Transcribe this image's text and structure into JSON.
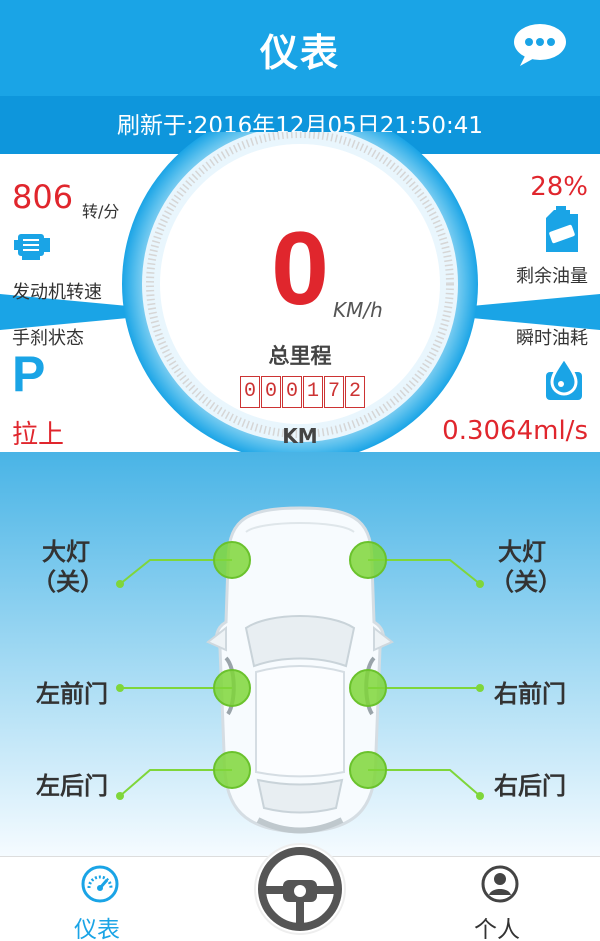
{
  "header": {
    "title": "仪表",
    "refresh_text": "刷新于:2016年12月05日21:50:41"
  },
  "engine": {
    "rpm": "806",
    "unit": "转/分",
    "label": "发动机转速"
  },
  "handbrake": {
    "label": "手刹状态",
    "icon_letter": "P",
    "value": "拉上"
  },
  "fuel": {
    "percent": "28%",
    "label": "剩余油量"
  },
  "instant_fuel": {
    "label": "瞬时油耗",
    "value": "0.3064ml/s"
  },
  "gauge": {
    "speed": "0",
    "speed_unit": "KM/h",
    "odometer_label": "总里程",
    "odometer_digits": [
      "0",
      "0",
      "0",
      "1",
      "7",
      "2"
    ],
    "odometer_unit": "KM"
  },
  "car": {
    "headlight_left_title": "大灯",
    "headlight_left_state": "（关）",
    "headlight_right_title": "大灯",
    "headlight_right_state": "（关）",
    "front_left_door": "左前门",
    "front_right_door": "右前门",
    "rear_left_door": "左后门",
    "rear_right_door": "右后门"
  },
  "nav": {
    "dashboard_label": "仪表",
    "me_label": "个人"
  },
  "colors": {
    "accent": "#1aa4e6",
    "alert": "#e0262d",
    "indicator": "#7fd63a"
  },
  "icons": [
    "chat-icon",
    "engine-icon",
    "parking-icon",
    "fuel-can-icon",
    "fuel-drop-icon",
    "gauge-icon",
    "steering-wheel-icon",
    "person-icon"
  ]
}
